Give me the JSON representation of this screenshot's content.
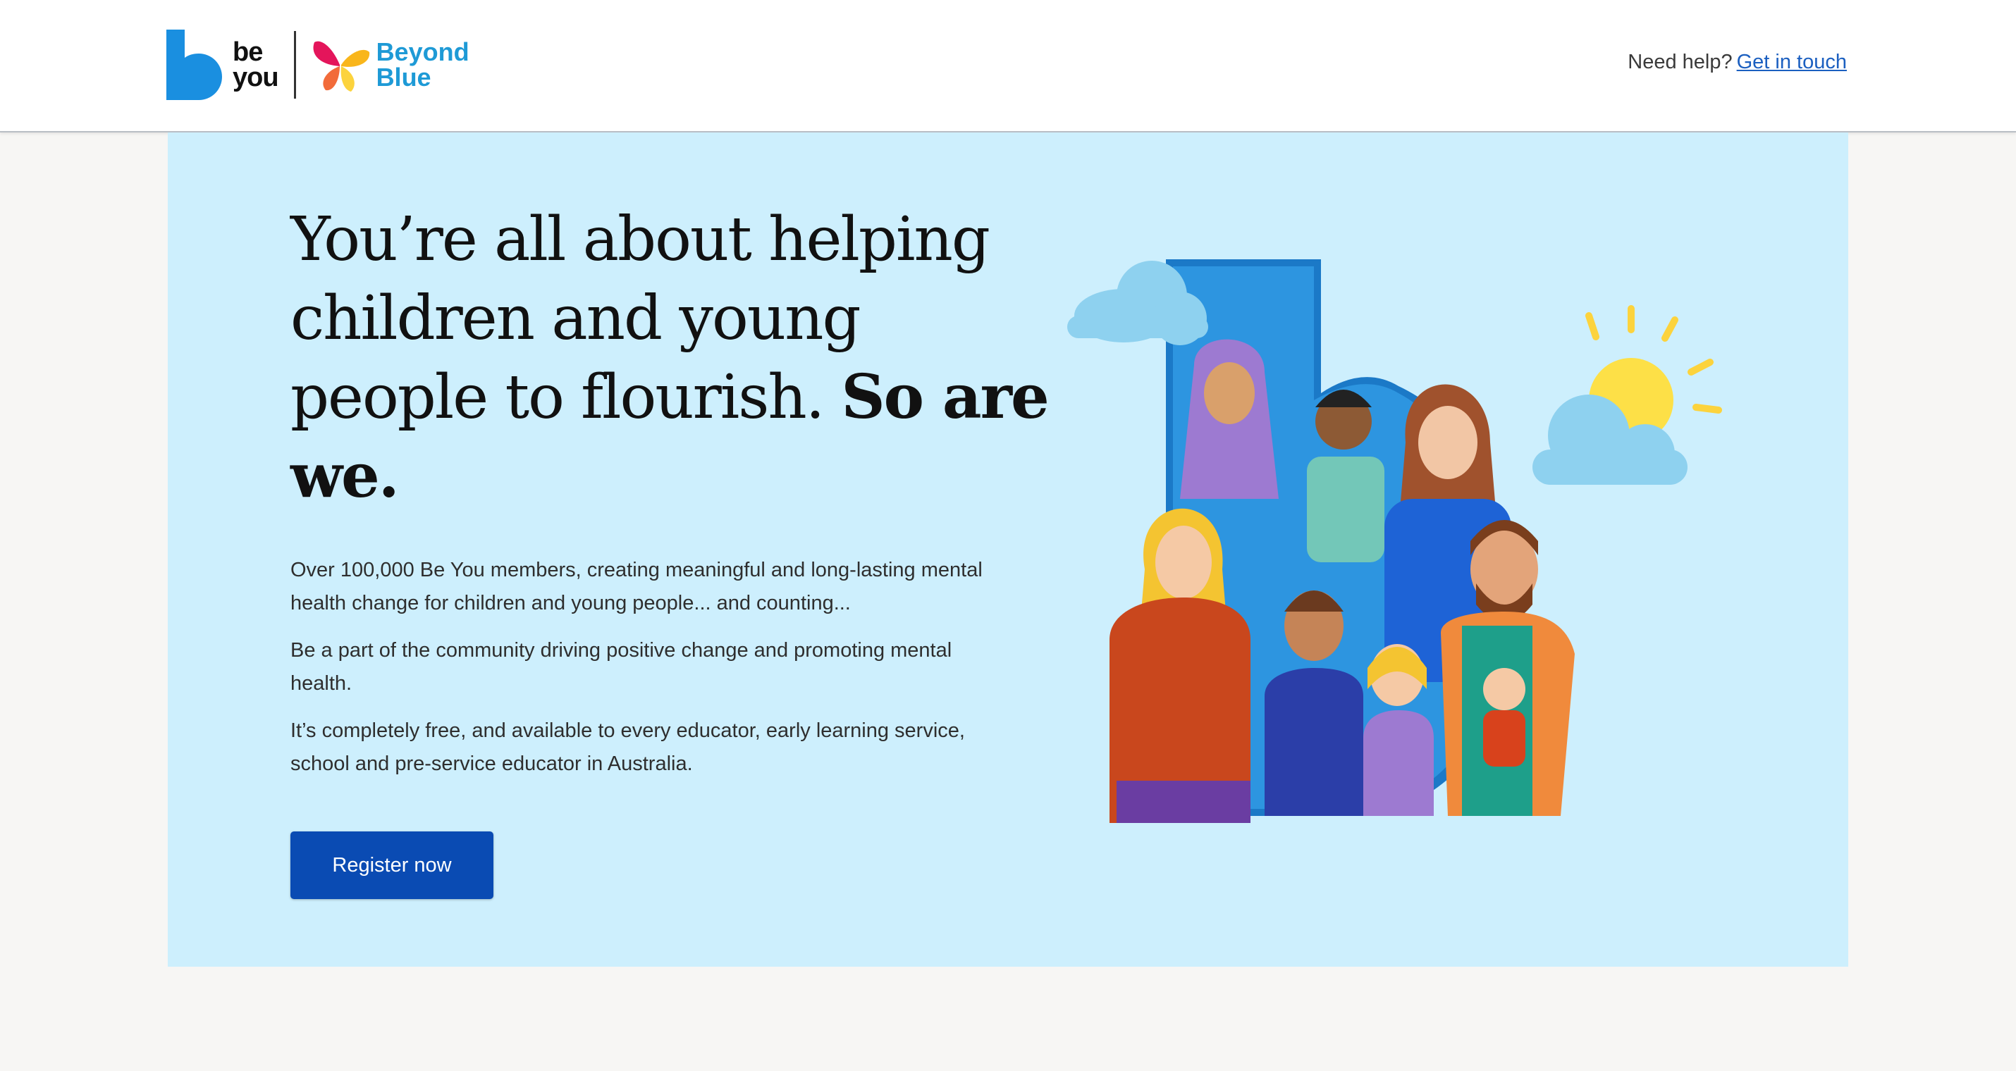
{
  "header": {
    "logo_be_top": "be",
    "logo_be_bottom": "you",
    "logo_beyond_top": "Beyond",
    "logo_beyond_bottom": "Blue",
    "help_text": "Need help?",
    "help_link": "Get in touch"
  },
  "hero": {
    "headline_regular": "You’re all about helping children and young people to flourish.",
    "headline_bold": "So are we.",
    "paragraphs": [
      "Over 100,000 Be You members, creating meaningful and long-lasting mental health change for children and young people... and counting...",
      "Be a part of the community driving positive change and promoting mental health.",
      "It’s completely free, and available to every educator, early learning service, school and pre-service educator in Australia."
    ],
    "cta_label": "Register now"
  },
  "colors": {
    "hero_bg": "#cdeffd",
    "brand_blue": "#0a4bb3",
    "link_blue": "#1b5fc0",
    "beyond_blue": "#1e9ad6"
  },
  "icons": [
    "be-you-logo-icon",
    "beyond-blue-butterfly-icon",
    "cloud-icon",
    "sun-icon"
  ]
}
